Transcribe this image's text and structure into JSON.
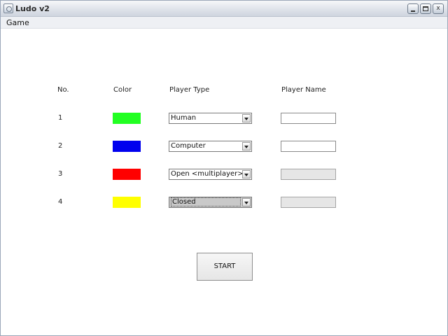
{
  "window": {
    "title": "Ludo v2",
    "controls": {
      "minimize": "minimize",
      "maximize": "maximize",
      "close": "x"
    }
  },
  "menu": {
    "items": [
      {
        "label": "Game"
      }
    ]
  },
  "table": {
    "headers": {
      "no": "No.",
      "color": "Color",
      "player_type": "Player Type",
      "player_name": "Player Name"
    },
    "rows": [
      {
        "no": "1",
        "color": "#22ff22",
        "player_type": "Human",
        "player_name": "",
        "name_enabled": true,
        "selected": false
      },
      {
        "no": "2",
        "color": "#0000ee",
        "player_type": "Computer",
        "player_name": "",
        "name_enabled": true,
        "selected": false
      },
      {
        "no": "3",
        "color": "#ff0000",
        "player_type": "Open <multiplayer>",
        "player_name": "",
        "name_enabled": false,
        "selected": false
      },
      {
        "no": "4",
        "color": "#ffff00",
        "player_type": "Closed",
        "player_name": "",
        "name_enabled": false,
        "selected": true
      }
    ]
  },
  "actions": {
    "start_label": "START"
  },
  "icons": {
    "app": "java-cup-icon",
    "dropdown": "chevron-down-icon"
  }
}
